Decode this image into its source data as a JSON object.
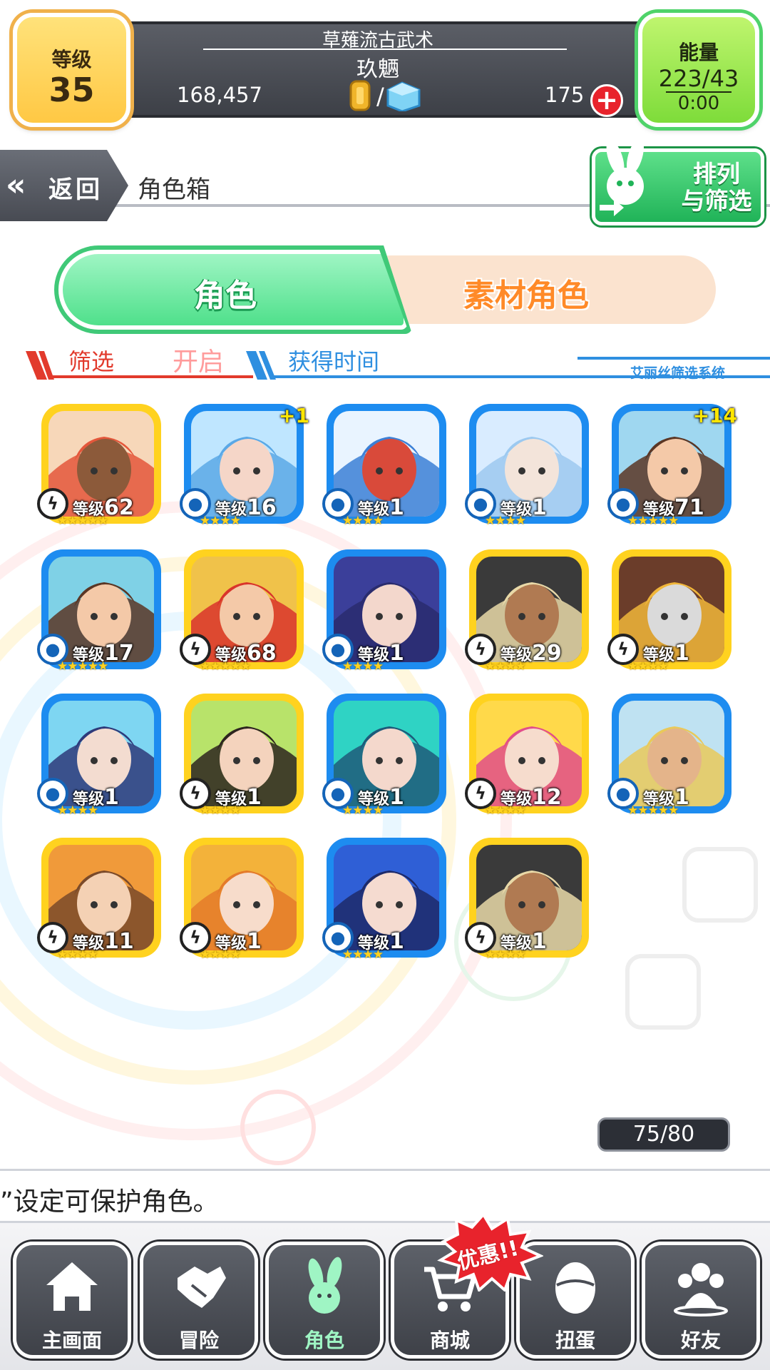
{
  "header": {
    "level_label": "等级",
    "level_value": "35",
    "school_name": "草薙流古武术",
    "player_name": "玖魉",
    "gold": "168,457",
    "currency_separator": "/",
    "gems": "175",
    "add_symbol": "+",
    "energy_label": "能量",
    "energy_value": "223/43",
    "energy_timer": "0:00"
  },
  "subheader": {
    "back_icon": "«",
    "back_label": "返回",
    "title": "角色箱",
    "sort_label_line1": "排列",
    "sort_label_line2": "与筛选"
  },
  "tabs": {
    "character": "角色",
    "material": "素材角色"
  },
  "filter": {
    "label": "筛选",
    "state": "开启",
    "sort_time": "获得时间",
    "system": "艾丽丝筛选系统"
  },
  "level_prefix": "等级",
  "cards": [
    {
      "frame": "gold",
      "element": "bolt",
      "level": "62",
      "stars": "★★★★★",
      "plus": "",
      "palette": [
        "#f7d7b9",
        "#e4573b",
        "#8c5a3a"
      ]
    },
    {
      "frame": "blue",
      "element": "water",
      "level": "16",
      "stars": "★★★★",
      "plus": "+1",
      "palette": [
        "#bfe6ff",
        "#5aa8e6",
        "#f5d6c8"
      ]
    },
    {
      "frame": "blue",
      "element": "water",
      "level": "1",
      "stars": "★★★★",
      "plus": "",
      "palette": [
        "#e9f4ff",
        "#3b7fd6",
        "#d94a3a"
      ]
    },
    {
      "frame": "blue",
      "element": "water",
      "level": "1",
      "stars": "★★★★",
      "plus": "",
      "palette": [
        "#d9ecff",
        "#9cc9f0",
        "#f3e4da"
      ]
    },
    {
      "frame": "blue",
      "element": "water",
      "level": "71",
      "stars": "★★★★★",
      "plus": "+14",
      "palette": [
        "#9fd7f0",
        "#5b3624",
        "#f4c9a8"
      ]
    },
    {
      "frame": "blue",
      "element": "water",
      "level": "17",
      "stars": "★★★★★",
      "plus": "",
      "palette": [
        "#7fd1e6",
        "#5b3624",
        "#f4c9a8"
      ]
    },
    {
      "frame": "gold",
      "element": "bolt",
      "level": "68",
      "stars": "★★★★★",
      "plus": "",
      "palette": [
        "#f0c24a",
        "#d9342b",
        "#f4c9a8"
      ]
    },
    {
      "frame": "blue",
      "element": "water",
      "level": "1",
      "stars": "★★★★",
      "plus": "",
      "palette": [
        "#3b3f9a",
        "#2a2c6e",
        "#f3d7cc"
      ]
    },
    {
      "frame": "gold",
      "element": "bolt",
      "level": "29",
      "stars": "★★★★",
      "plus": "",
      "palette": [
        "#3a3a3a",
        "#e9d9a8",
        "#b07a52"
      ]
    },
    {
      "frame": "gold",
      "element": "bolt",
      "level": "1",
      "stars": "★★★★",
      "plus": "",
      "palette": [
        "#6b3d2a",
        "#f0b63a",
        "#dadada"
      ]
    },
    {
      "frame": "blue",
      "element": "water",
      "level": "1",
      "stars": "★★★★",
      "plus": "",
      "palette": [
        "#7ed6f2",
        "#2e3a7a",
        "#f3dcd0"
      ]
    },
    {
      "frame": "gold",
      "element": "bolt",
      "level": "1",
      "stars": "★★★★",
      "plus": "",
      "palette": [
        "#b8e36a",
        "#2d241f",
        "#f4d3bd"
      ]
    },
    {
      "frame": "blue",
      "element": "water",
      "level": "1",
      "stars": "★★★★",
      "plus": "",
      "palette": [
        "#2fd3c4",
        "#1e5a7a",
        "#f4d8cc"
      ]
    },
    {
      "frame": "gold",
      "element": "bolt",
      "level": "12",
      "stars": "★★★★",
      "plus": "",
      "palette": [
        "#ffd94a",
        "#e24e8a",
        "#f6dccd"
      ]
    },
    {
      "frame": "blue",
      "element": "water",
      "level": "1",
      "stars": "★★★★★",
      "plus": "",
      "palette": [
        "#bfe2f2",
        "#e9c95a",
        "#e4b48a"
      ]
    },
    {
      "frame": "gold",
      "element": "bolt",
      "level": "11",
      "stars": "★★★★",
      "plus": "",
      "palette": [
        "#f09a3a",
        "#7a4a2a",
        "#f4d1b4"
      ]
    },
    {
      "frame": "gold",
      "element": "bolt",
      "level": "1",
      "stars": "★★★★",
      "plus": "",
      "palette": [
        "#f3b23a",
        "#e47a2a",
        "#f7dccb"
      ]
    },
    {
      "frame": "blue",
      "element": "water",
      "level": "1",
      "stars": "★★★★",
      "plus": "",
      "palette": [
        "#2f5fd6",
        "#1d2a6a",
        "#f5dbd0"
      ]
    },
    {
      "frame": "gold",
      "element": "bolt",
      "level": "1",
      "stars": "★★★★",
      "plus": "",
      "palette": [
        "#3a3a3a",
        "#e9d9a8",
        "#b07a52"
      ]
    }
  ],
  "count": "75/80",
  "tip": "”设定可保护角色。",
  "promo": "优惠!!",
  "nav": [
    {
      "label": "主画面",
      "icon": "home-icon"
    },
    {
      "label": "冒险",
      "icon": "handshake-icon"
    },
    {
      "label": "角色",
      "icon": "bunny-icon"
    },
    {
      "label": "商城",
      "icon": "cart-icon"
    },
    {
      "label": "扭蛋",
      "icon": "egg-icon"
    },
    {
      "label": "好友",
      "icon": "friends-icon"
    }
  ],
  "colors": {
    "gold_frame": "#ffd21f",
    "blue_frame": "#1d8cf0",
    "accent_green": "#4fe08b",
    "accent_orange": "#ff8a28",
    "filter_red": "#e23a2c",
    "sort_blue": "#2f8fe0"
  }
}
